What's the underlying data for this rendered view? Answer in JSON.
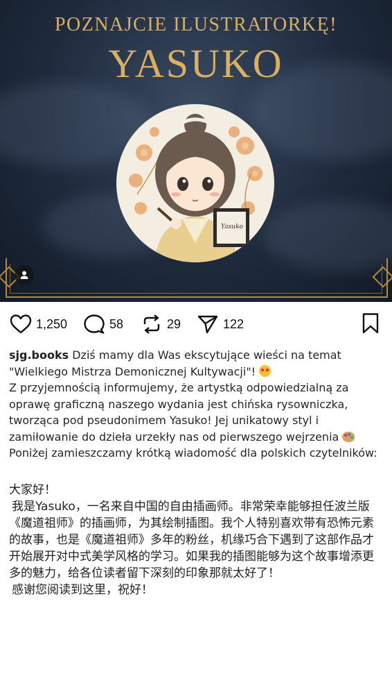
{
  "hero": {
    "title": "POZNAJCIE ILUSTRATORKĘ!",
    "name": "YASUKO",
    "avatar_signature": "Yasuko",
    "tag_icon": "person-icon"
  },
  "actions": {
    "likes": "1,250",
    "comments": "58",
    "reposts": "29",
    "shares": "122",
    "icons": [
      "heart-icon",
      "comment-icon",
      "repost-icon",
      "send-icon",
      "bookmark-icon"
    ]
  },
  "caption": {
    "username": "sjg.books",
    "line1": "Dziś mamy dla Was ekscytujące wieści na temat \"Wielkiego Mistrza Demonicznej Kultywacji\"!",
    "line2": "Z przyjemnością informujemy, że artystką odpowiedzialną za oprawę graficzną naszego wydania jest chińska rysowniczka, tworząca pod pseudonimem Yasuko! Jej unikatowy styl i zamiłowanie do dzieła urzekły nas od pierwszego wejrzenia",
    "line3": "Poniżej zamieszczamy krótką wiadomość dla polskich czytelników:",
    "zh_greeting": "大家好！",
    "zh_body": "我是Yasuko，一名来自中国的自由插画师。非常荣幸能够担任波兰版《魔道祖师》的插画师，为其绘制插图。我个人特别喜欢带有恐怖元素的故事，也是《魔道祖师》多年的粉丝，机缘巧合下遇到了这部作品才开始展开对中式美学风格的学习。如果我的插图能够为这个故事增添更多的魅力，给各位读者留下深刻的印象那就太好了！",
    "zh_closing": "感谢您阅读到这里，祝好！"
  }
}
